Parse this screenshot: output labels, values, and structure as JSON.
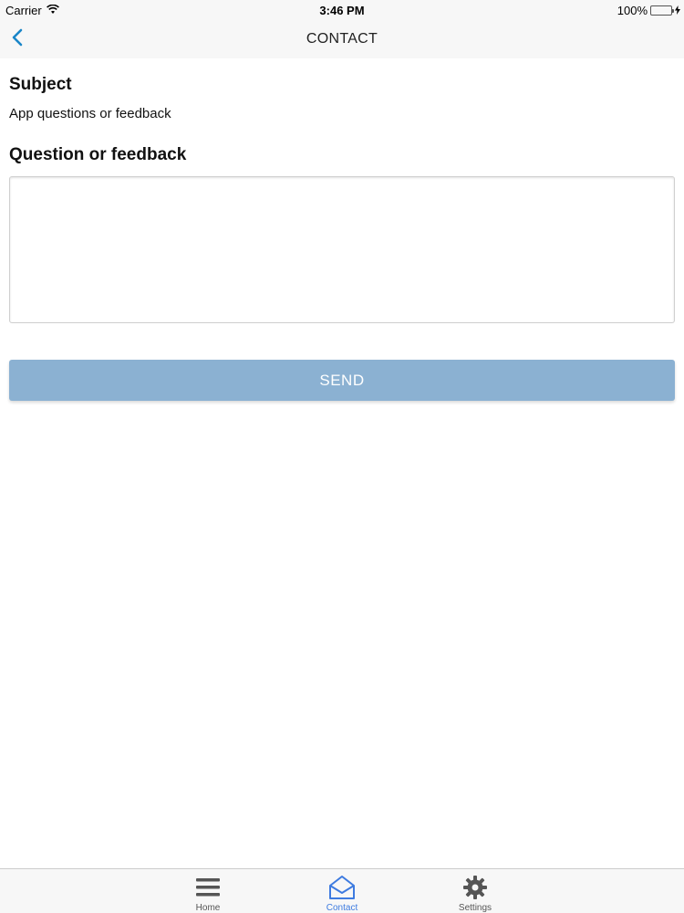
{
  "status_bar": {
    "carrier": "Carrier",
    "time": "3:46 PM",
    "battery": "100%"
  },
  "nav": {
    "title": "CONTACT",
    "back_icon": "chevron-left-icon"
  },
  "form": {
    "subject_label": "Subject",
    "subject_value": "App questions or feedback",
    "feedback_label": "Question or feedback",
    "feedback_value": "",
    "send_label": "SEND"
  },
  "tabs": [
    {
      "label": "Home",
      "icon": "menu-icon"
    },
    {
      "label": "Contact",
      "icon": "envelope-open-icon"
    },
    {
      "label": "Settings",
      "icon": "gear-icon"
    }
  ],
  "colors": {
    "accent": "#3e7be0",
    "send_button": "#8bb1d2",
    "battery": "#4cd964",
    "back_chevron": "#1a86c8"
  }
}
